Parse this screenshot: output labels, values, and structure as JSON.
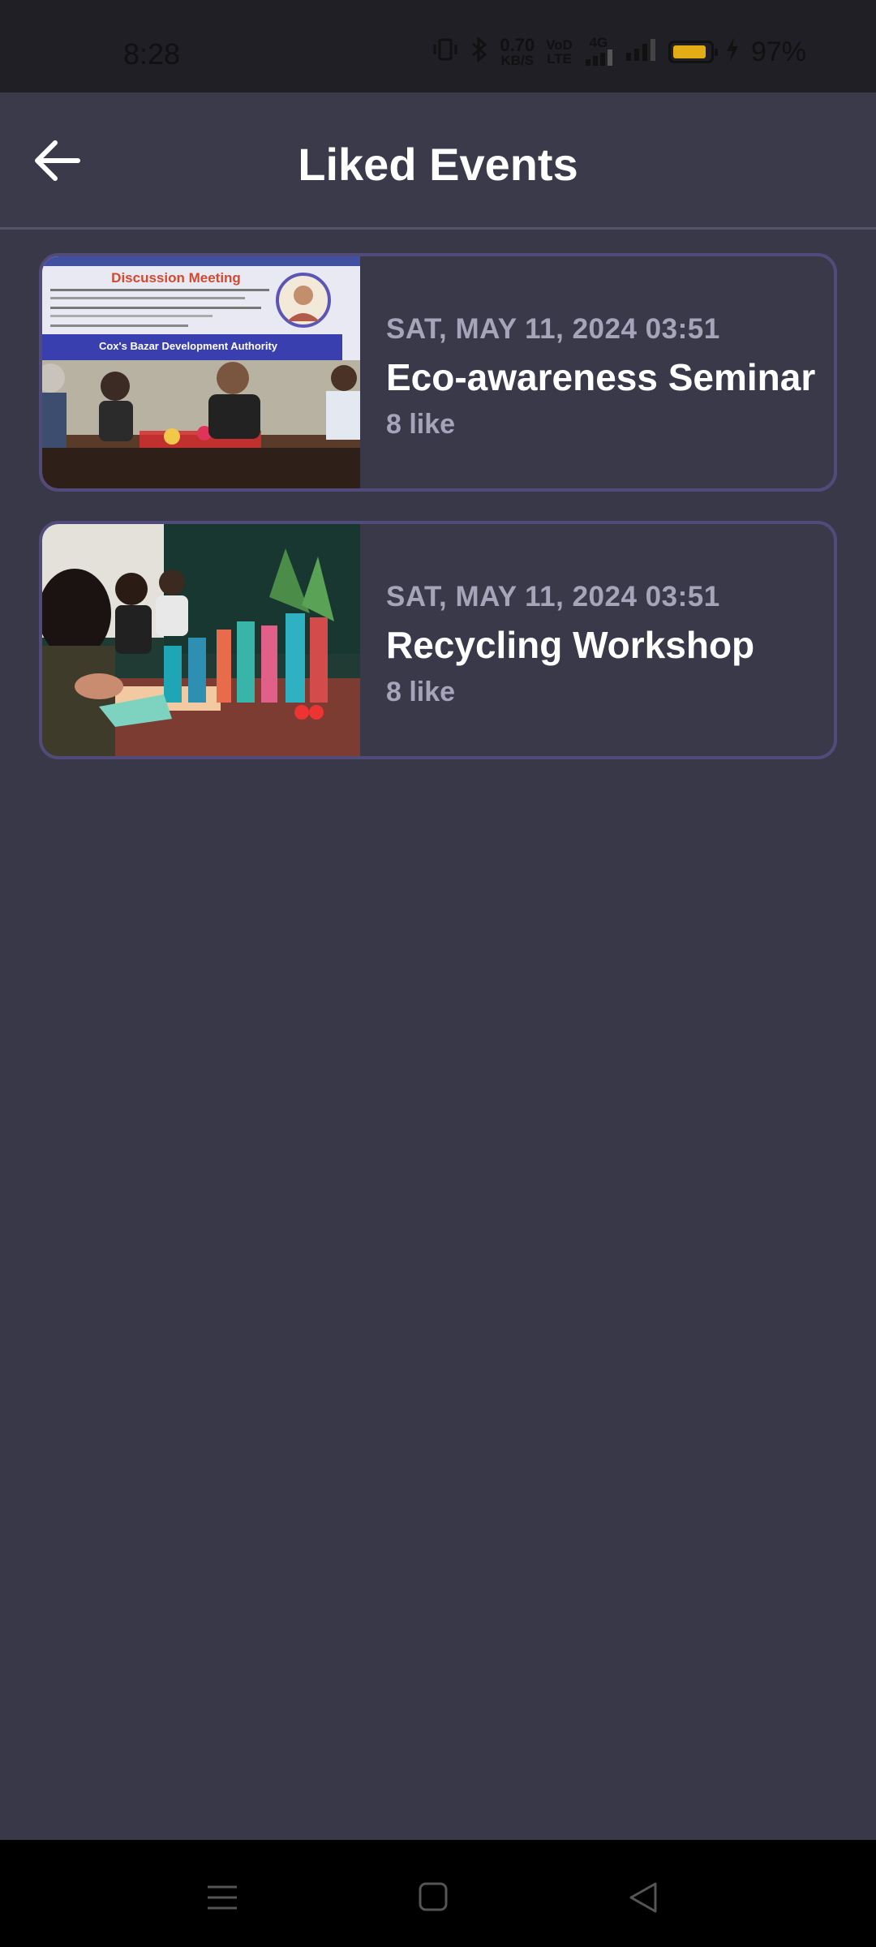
{
  "status_bar": {
    "time": "8:28",
    "net_speed_value": "0.70",
    "net_speed_unit": "KB/S",
    "vo_top": "VoD",
    "vo_bottom": "LTE",
    "network": "4G",
    "battery_percent": 97,
    "battery_text": "97%",
    "battery_color": "#e3ad15"
  },
  "header": {
    "title": "Liked Events",
    "back_icon": "arrow-left-icon"
  },
  "events": [
    {
      "date": "SAT, MAY 11, 2024 03:51",
      "title": "Eco-awareness Seminar",
      "likes": "8 like",
      "banner_title": "Discussion Meeting",
      "banner_org": "Cox's Bazar Development Authority"
    },
    {
      "date": "SAT, MAY 11, 2024 03:51",
      "title": "Recycling Workshop",
      "likes": "8 like"
    }
  ],
  "nav_bar": {
    "menu_icon": "menu-icon",
    "home_icon": "home-square-icon",
    "back_icon": "back-triangle-icon"
  }
}
